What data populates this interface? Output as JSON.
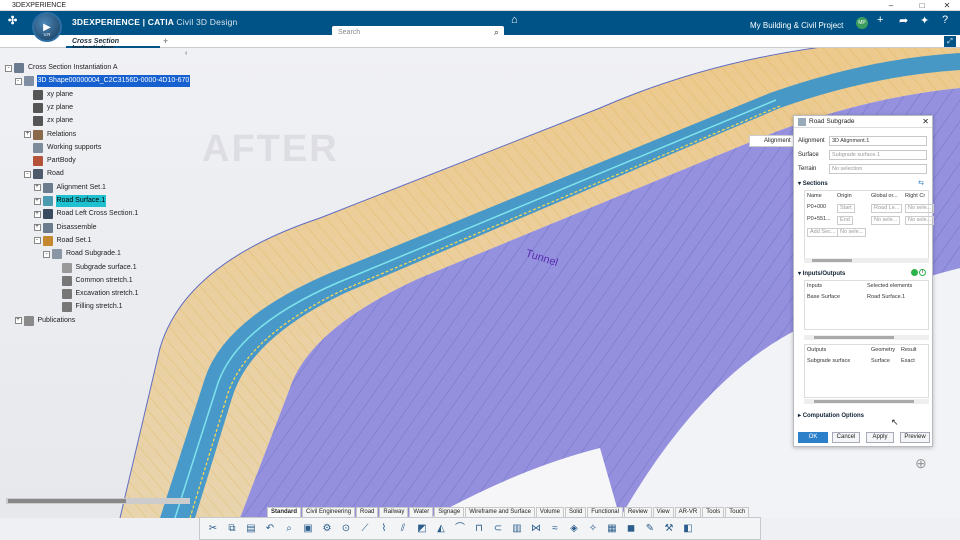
{
  "window": {
    "title": "3DEXPERIENCE",
    "min": "–",
    "max": "□",
    "close": "✕"
  },
  "appbar": {
    "brand_bold": "3DEXPERIENCE | CATIA",
    "brand_app": "Civil 3D Design",
    "compass_version": "V.R",
    "search_placeholder": "Search",
    "project": "My Building & Civil Project",
    "avatar": "MP"
  },
  "tabs": {
    "active": "Cross Section Instantiation",
    "add": "+"
  },
  "viewport": {
    "watermark": "AFTER",
    "label_tunnel": "Tunnel",
    "label_alignment": "Alignment"
  },
  "tree": [
    {
      "label": "Cross Section Instantiation A",
      "depth": 0,
      "exp": "-"
    },
    {
      "label": "3D Shape00000004_C2C3156D-0000-4D10-670",
      "depth": 1,
      "exp": "-",
      "state": "selected"
    },
    {
      "label": "xy plane",
      "depth": 2,
      "exp": ""
    },
    {
      "label": "yz plane",
      "depth": 2,
      "exp": ""
    },
    {
      "label": "zx plane",
      "depth": 2,
      "exp": ""
    },
    {
      "label": "Relations",
      "depth": 2,
      "exp": "+"
    },
    {
      "label": "Working supports",
      "depth": 2,
      "exp": ""
    },
    {
      "label": "PartBody",
      "depth": 2,
      "exp": ""
    },
    {
      "label": "Road",
      "depth": 2,
      "exp": "-"
    },
    {
      "label": "Alignment Set.1",
      "depth": 3,
      "exp": "+"
    },
    {
      "label": "Road Surface.1",
      "depth": 3,
      "exp": "+",
      "state": "highlight"
    },
    {
      "label": "Road Left Cross Section.1",
      "depth": 3,
      "exp": "+"
    },
    {
      "label": "Disassemble",
      "depth": 3,
      "exp": "+"
    },
    {
      "label": "Road Set.1",
      "depth": 3,
      "exp": "-"
    },
    {
      "label": "Road Subgrade.1",
      "depth": 4,
      "exp": "-"
    },
    {
      "label": "Subgrade surface.1",
      "depth": 5,
      "exp": ""
    },
    {
      "label": "Common stretch.1",
      "depth": 5,
      "exp": ""
    },
    {
      "label": "Excavation stretch.1",
      "depth": 5,
      "exp": ""
    },
    {
      "label": "Filling stretch.1",
      "depth": 5,
      "exp": ""
    },
    {
      "label": "Publications",
      "depth": 1,
      "exp": "+"
    }
  ],
  "dialog": {
    "title": "Road Subgrade",
    "alignment_label": "Alignment",
    "alignment_value": "3D Alignment.1",
    "surface_label": "Surface",
    "surface_value": "Subgrade surface.1",
    "terrain_label": "Terrain",
    "terrain_value": "No selection",
    "sections_title": "Sections",
    "sections_headers": [
      "Name",
      "Origin",
      "Global or...",
      "Right Cr"
    ],
    "sections_rows": [
      [
        "P0+000",
        "Start",
        "Road Le...",
        "No sele..."
      ],
      [
        "P0+551...",
        "End",
        "No sele...",
        "No sele..."
      ],
      [
        "Add Sec...",
        "No sele...",
        "",
        ""
      ]
    ],
    "io_title": "Inputs/Outputs",
    "inputs_headers": [
      "Inputs",
      "Selected elements"
    ],
    "inputs_rows": [
      [
        "Base Surface",
        "Road Surface.1"
      ]
    ],
    "outputs_headers": [
      "Outputs",
      "Geometry",
      "Result"
    ],
    "outputs_rows": [
      [
        "Subgrade surface",
        "Surface",
        "Exact"
      ]
    ],
    "computation_title": "Computation Options",
    "ok": "OK",
    "cancel": "Cancel",
    "apply": "Apply",
    "preview": "Preview"
  },
  "workbench_tabs": [
    "Standard",
    "Civil Engineering",
    "Road",
    "Railway",
    "Water",
    "Signage",
    "Wireframe and Surface",
    "Volume",
    "Solid",
    "Functional",
    "Review",
    "View",
    "AR-VR",
    "Tools",
    "Touch"
  ],
  "toolbar_icons": [
    "cut-icon",
    "copy-icon",
    "paste-icon",
    "undo-icon",
    "zoom-icon",
    "catalog-icon",
    "settings-icon",
    "measure-icon",
    "road-icon",
    "alignment-icon",
    "cross-section-icon",
    "subgrade-icon",
    "terrain-icon",
    "slope-icon",
    "bridge-icon",
    "tunnel-icon",
    "wall-icon",
    "railway-icon",
    "water-icon",
    "sign-icon",
    "light-icon",
    "volume-icon",
    "solid-icon",
    "review-icon",
    "tools-icon",
    "view-icon"
  ],
  "colors": {
    "brand": "#005386",
    "selection": "#1660d0",
    "highlight": "#1fc0d0",
    "road_surface": "#8a86d8",
    "embankment": "#e8c589"
  }
}
